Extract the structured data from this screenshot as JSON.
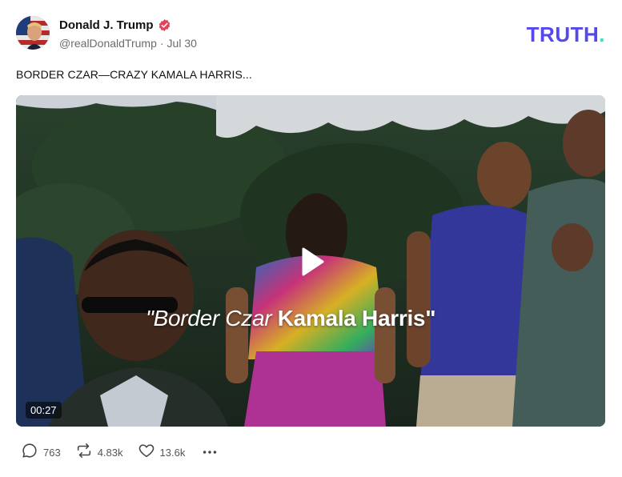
{
  "author": {
    "name": "Donald J. Trump",
    "handle": "@realDonaldTrump",
    "separator": "·",
    "date": "Jul 30"
  },
  "brand": {
    "word": "TRUTH",
    "dot": "."
  },
  "post": {
    "text": "BORDER CZAR—CRAZY KAMALA HARRIS..."
  },
  "video": {
    "caption_light": "\"Border Czar ",
    "caption_bold": "Kamala Harris\"",
    "duration": "00:27"
  },
  "actions": {
    "replies": "763",
    "retruths": "4.83k",
    "likes": "13.6k"
  },
  "icons": {
    "verified": "verified-badge-icon",
    "reply": "reply-icon",
    "retruth": "retruth-icon",
    "like": "heart-icon",
    "more": "more-icon",
    "play": "play-icon"
  },
  "colors": {
    "brand": "#5448ee",
    "brand_accent": "#36e4b8",
    "verified": "#e8425a",
    "muted": "#6b6b6b"
  }
}
